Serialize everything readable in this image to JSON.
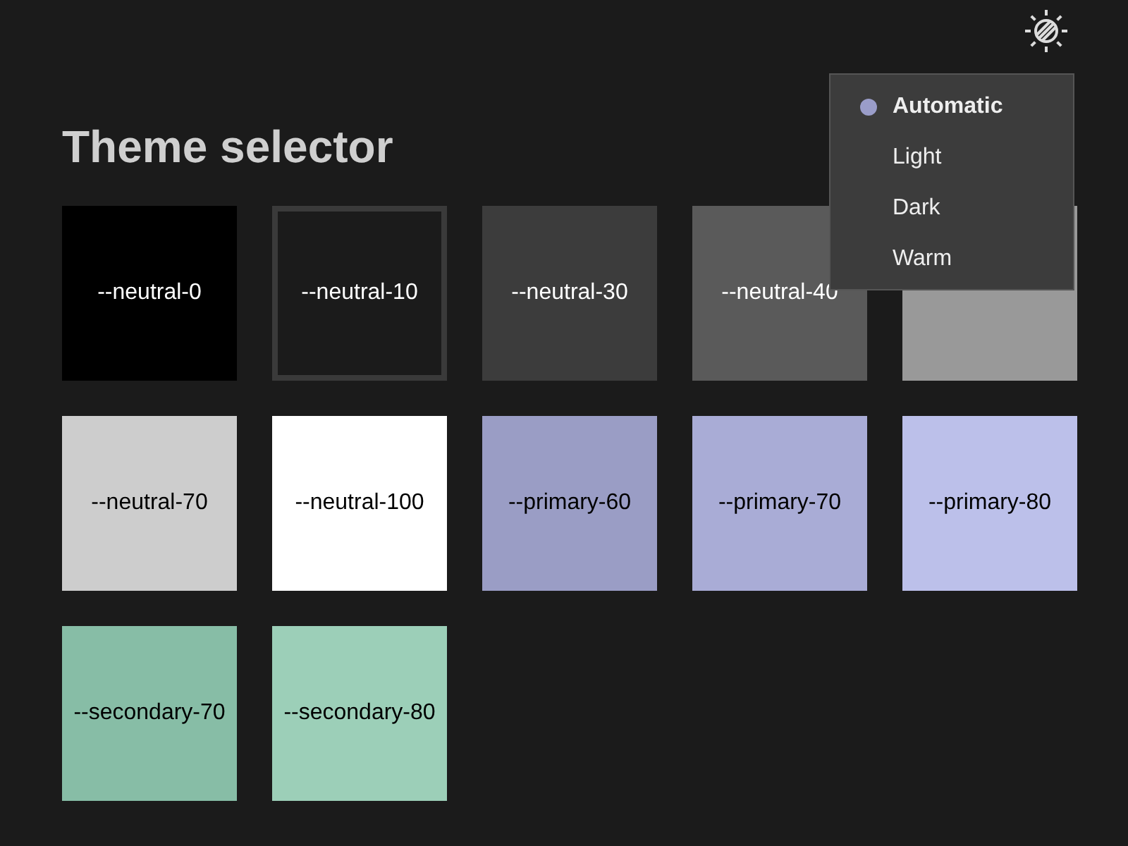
{
  "title": "Theme selector",
  "swatches": [
    {
      "label": "--neutral-0",
      "color": "#000000"
    },
    {
      "label": "--neutral-10",
      "color": "#1b1b1b"
    },
    {
      "label": "--neutral-30",
      "color": "#3c3c3c"
    },
    {
      "label": "--neutral-40",
      "color": "#5a5a5a"
    },
    {
      "color": "#999999"
    },
    {
      "label": "--neutral-70",
      "color": "#cdcdcd"
    },
    {
      "label": "--neutral-100",
      "color": "#ffffff"
    },
    {
      "label": "--primary-60",
      "color": "#9a9dc5"
    },
    {
      "label": "--primary-70",
      "color": "#a9acd6"
    },
    {
      "label": "--primary-80",
      "color": "#bcc0ea"
    },
    {
      "label": "--secondary-70",
      "color": "#87bda6"
    },
    {
      "label": "--secondary-80",
      "color": "#9ccfb8"
    }
  ],
  "theme_menu": {
    "expanded": true,
    "options": [
      {
        "label": "Automatic",
        "selected": true
      },
      {
        "label": "Light",
        "selected": false
      },
      {
        "label": "Dark",
        "selected": false
      },
      {
        "label": "Warm",
        "selected": false
      }
    ]
  }
}
